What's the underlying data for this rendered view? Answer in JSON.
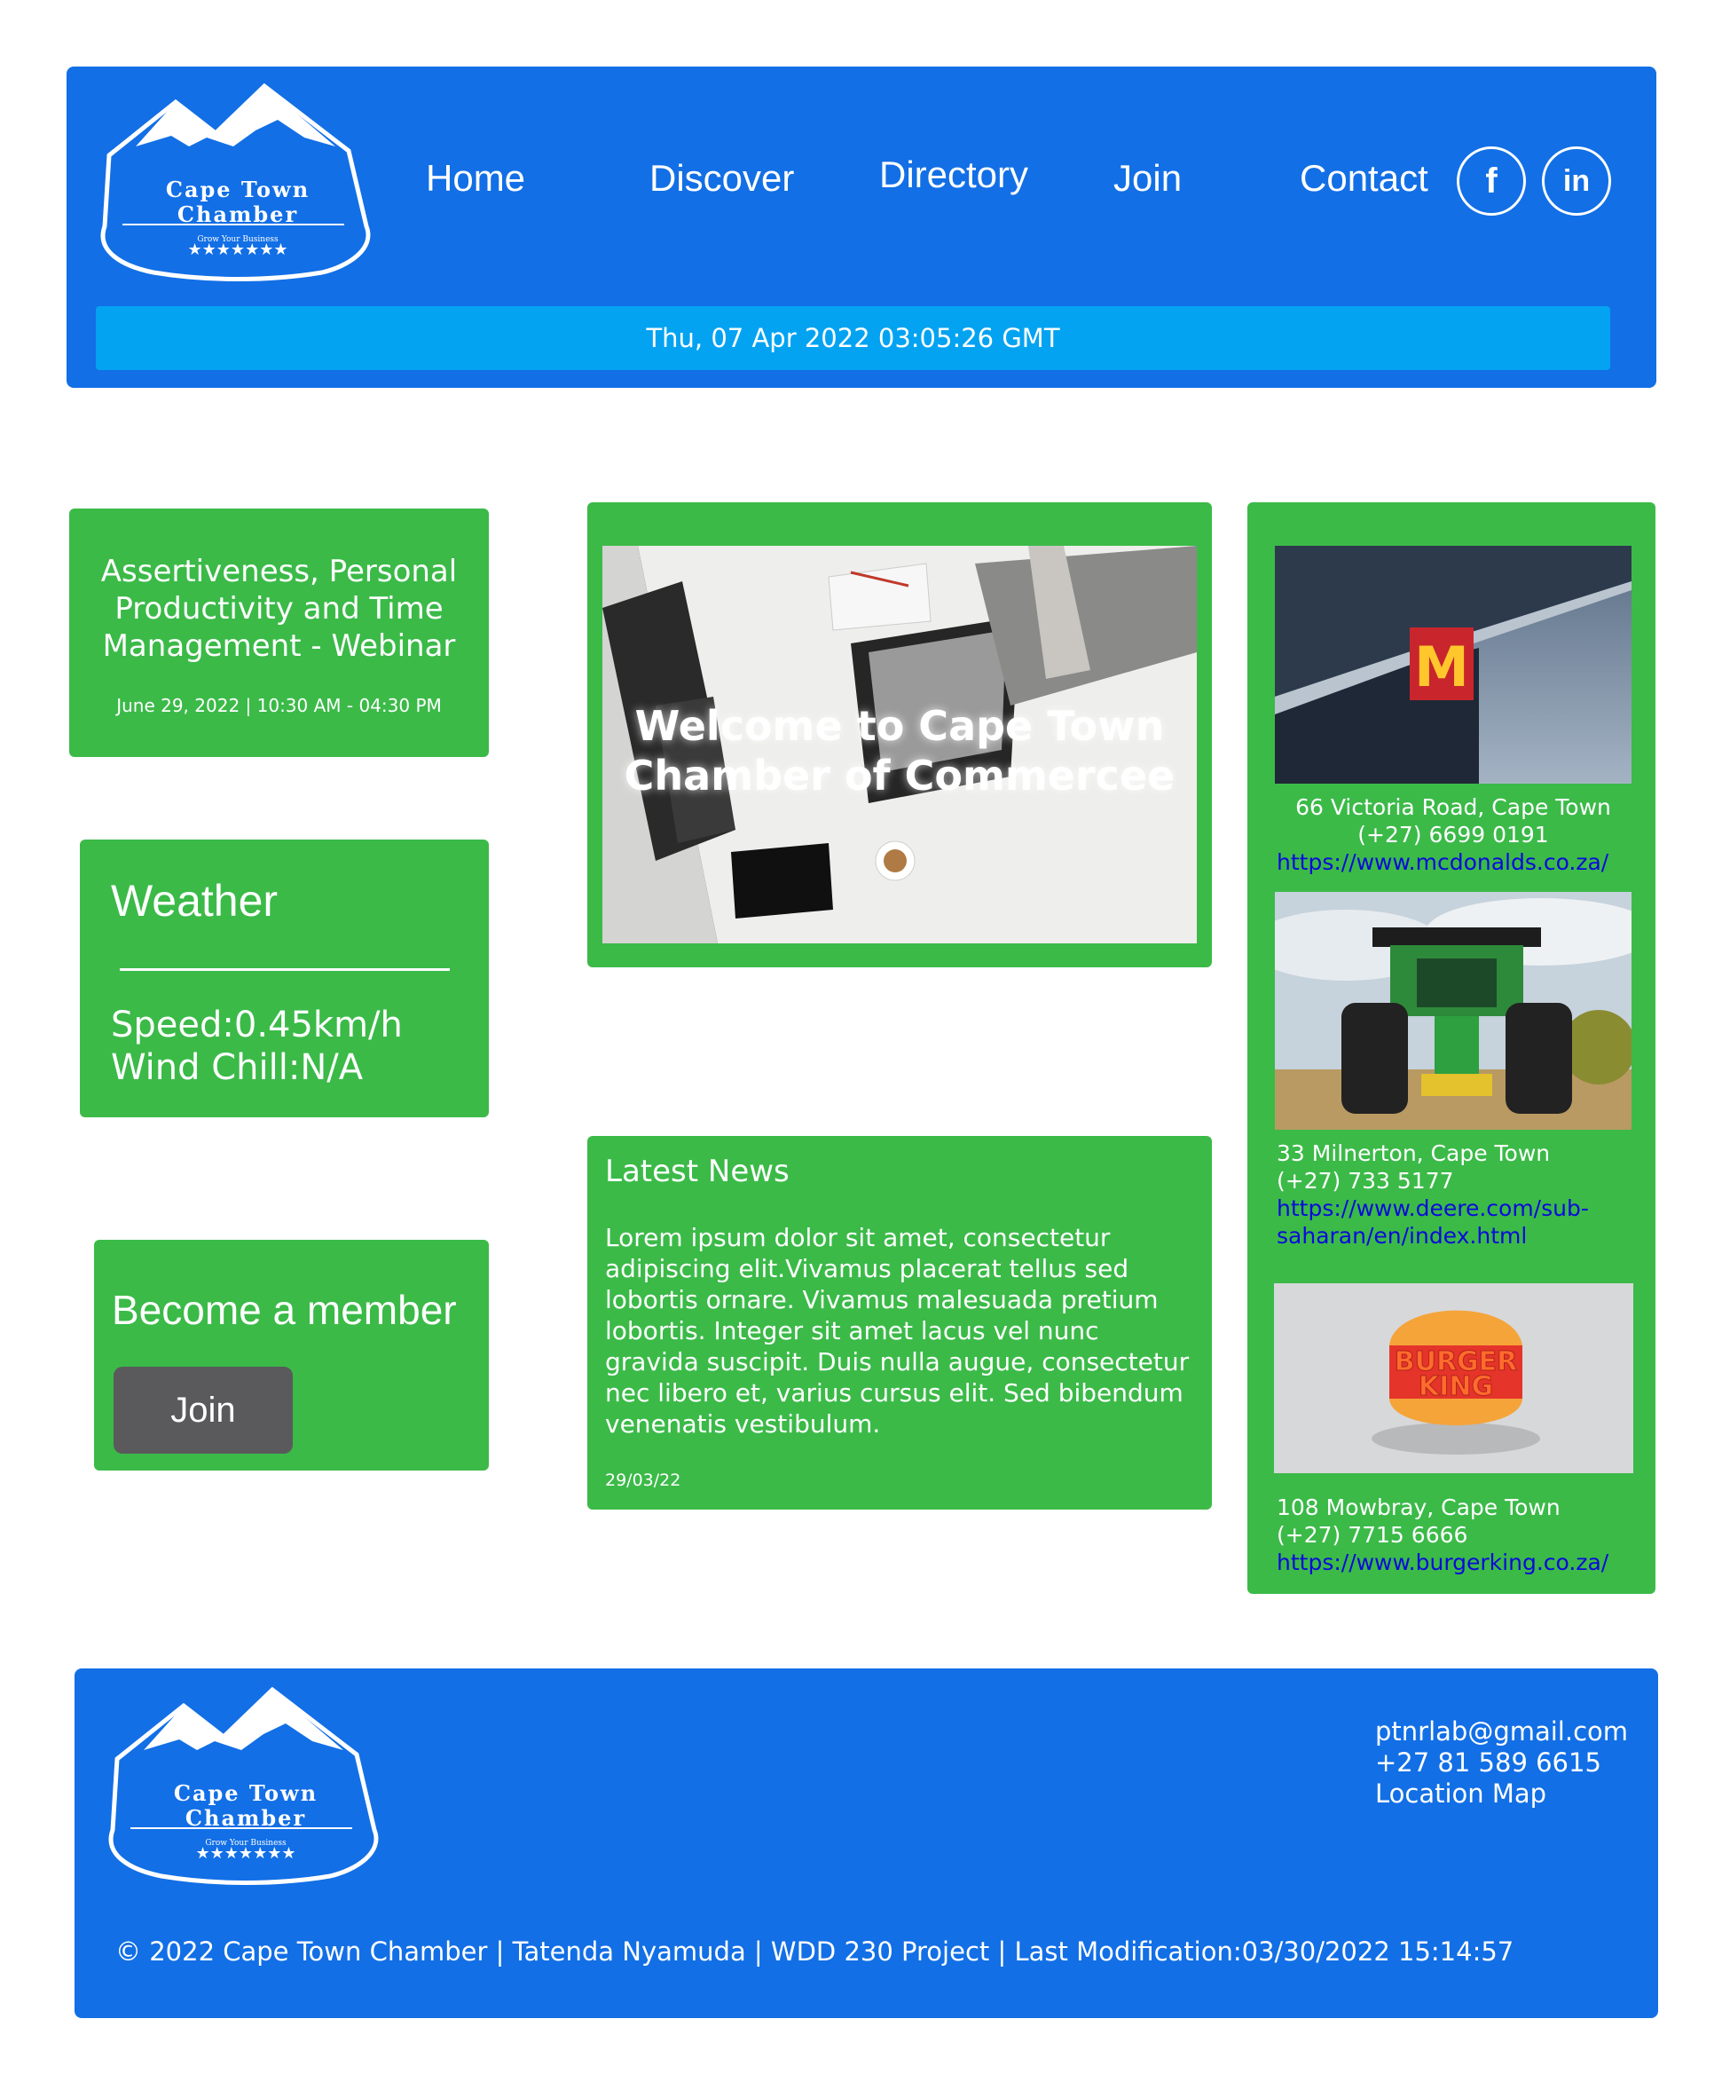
{
  "header": {
    "logo": {
      "line1": "Cape Town",
      "line2": "Chamber",
      "tagline": "Grow Your Business"
    },
    "nav": [
      "Home",
      "Discover",
      "Directory",
      "Join",
      "Contact"
    ],
    "social": {
      "facebook": "f",
      "linkedin": "in"
    },
    "date": "Thu, 07 Apr 2022 03:05:26 GMT"
  },
  "event": {
    "title": "Assertiveness, Personal Productivity and Time Management - Webinar",
    "date": "June 29, 2022 | 10:30 AM - 04:30 PM"
  },
  "weather": {
    "title": "Weather",
    "speed": "Speed:0.45km/h",
    "wind_chill": "Wind Chill:N/A"
  },
  "member": {
    "title": "Become a member",
    "button": "Join"
  },
  "hero": {
    "headline": "Welcome to Cape Town Chamber of Commercee"
  },
  "news": {
    "title": "Latest News",
    "body": "Lorem ipsum dolor sit amet, consectetur adipiscing elit.Vivamus placerat tellus sed lobortis ornare. Vivamus malesuada pretium lobortis. Integer sit amet lacus vel nunc gravida suscipit. Duis nulla augue, consectetur nec libero et, varius cursus elit. Sed bibendum venenatis vestibulum.",
    "date": "29/03/22"
  },
  "directory": [
    {
      "address": "66 Victoria Road, Cape Town",
      "phone": "(+27) 6699 0191",
      "url": "https://www.mcdonalds.co.za/",
      "image": "mcdonalds-storefront",
      "image_text": "M"
    },
    {
      "address": "33 Milnerton, Cape Town",
      "phone": "(+27) 733 5177",
      "url_line1": "https://www.deere.com/sub-",
      "url_line2": "saharan/en/index.html",
      "image": "green-tractor"
    },
    {
      "address": "108 Mowbray, Cape Town",
      "phone": "(+27) 7715 6666",
      "url": "https://www.burgerking.co.za/",
      "image": "burger-king-logo",
      "image_text_1": "BURGER",
      "image_text_2": "KING"
    }
  ],
  "footer": {
    "logo": {
      "line1": "Cape Town",
      "line2": "Chamber",
      "tagline": "Grow Your Business"
    },
    "email": "ptnrlab@gmail.com",
    "phone": "+27 81 589 6615",
    "map": "Location Map",
    "copyright": "© 2022 Cape Town Chamber | Tatenda Nyamuda | WDD 230 Project | Last Modification:03/30/2022 15:14:57"
  },
  "colors": {
    "header_blue": "#126fe6",
    "date_bar": "#03a3f2",
    "card_green": "#3bba48",
    "join_button": "#5a5a5c",
    "link_blue": "#0a0adb"
  }
}
